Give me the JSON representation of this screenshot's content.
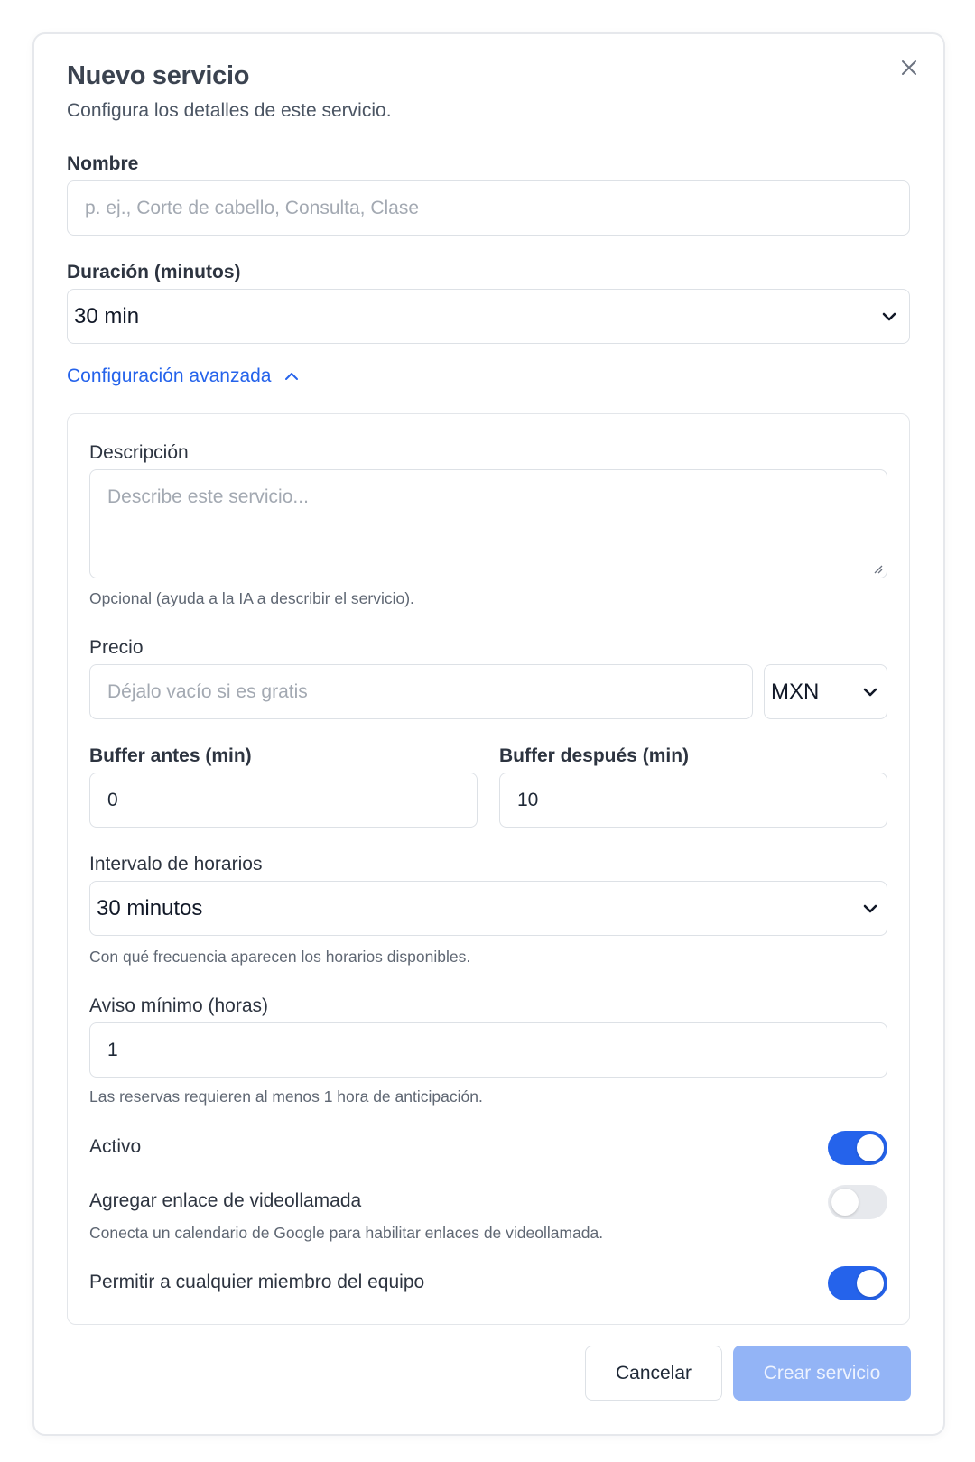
{
  "dialog": {
    "title": "Nuevo servicio",
    "subtitle": "Configura los detalles de este servicio.",
    "close_icon": "close-icon"
  },
  "name": {
    "label": "Nombre",
    "placeholder": "p. ej., Corte de cabello, Consulta, Clase",
    "value": ""
  },
  "duration": {
    "label": "Duración (minutos)",
    "selected": "30 min"
  },
  "advanced": {
    "toggle_label": "Configuración avanzada",
    "expanded": true,
    "description": {
      "label": "Descripción",
      "placeholder": "Describe este servicio...",
      "help": "Opcional (ayuda a la IA a describir el servicio)."
    },
    "price": {
      "label": "Precio",
      "placeholder": "Déjalo vacío si es gratis",
      "currency": "MXN"
    },
    "buffer_before": {
      "label": "Buffer antes (min)",
      "value": "0"
    },
    "buffer_after": {
      "label": "Buffer después (min)",
      "value": "10"
    },
    "slot_interval": {
      "label": "Intervalo de horarios",
      "selected": "30 minutos",
      "help": "Con qué frecuencia aparecen los horarios disponibles."
    },
    "min_notice": {
      "label": "Aviso mínimo (horas)",
      "value": "1",
      "help": "Las reservas requieren al menos 1 hora de anticipación."
    },
    "active": {
      "label": "Activo",
      "on": true
    },
    "video_link": {
      "label": "Agregar enlace de videollamada",
      "help": "Conecta un calendario de Google para habilitar enlaces de videollamada.",
      "on": false
    },
    "any_member": {
      "label": "Permitir a cualquier miembro del equipo",
      "on": true
    }
  },
  "footer": {
    "cancel_label": "Cancelar",
    "submit_label": "Crear servicio"
  },
  "colors": {
    "accent": "#2563eb",
    "primary_disabled": "#93b4f6",
    "border": "#dde1e6"
  }
}
